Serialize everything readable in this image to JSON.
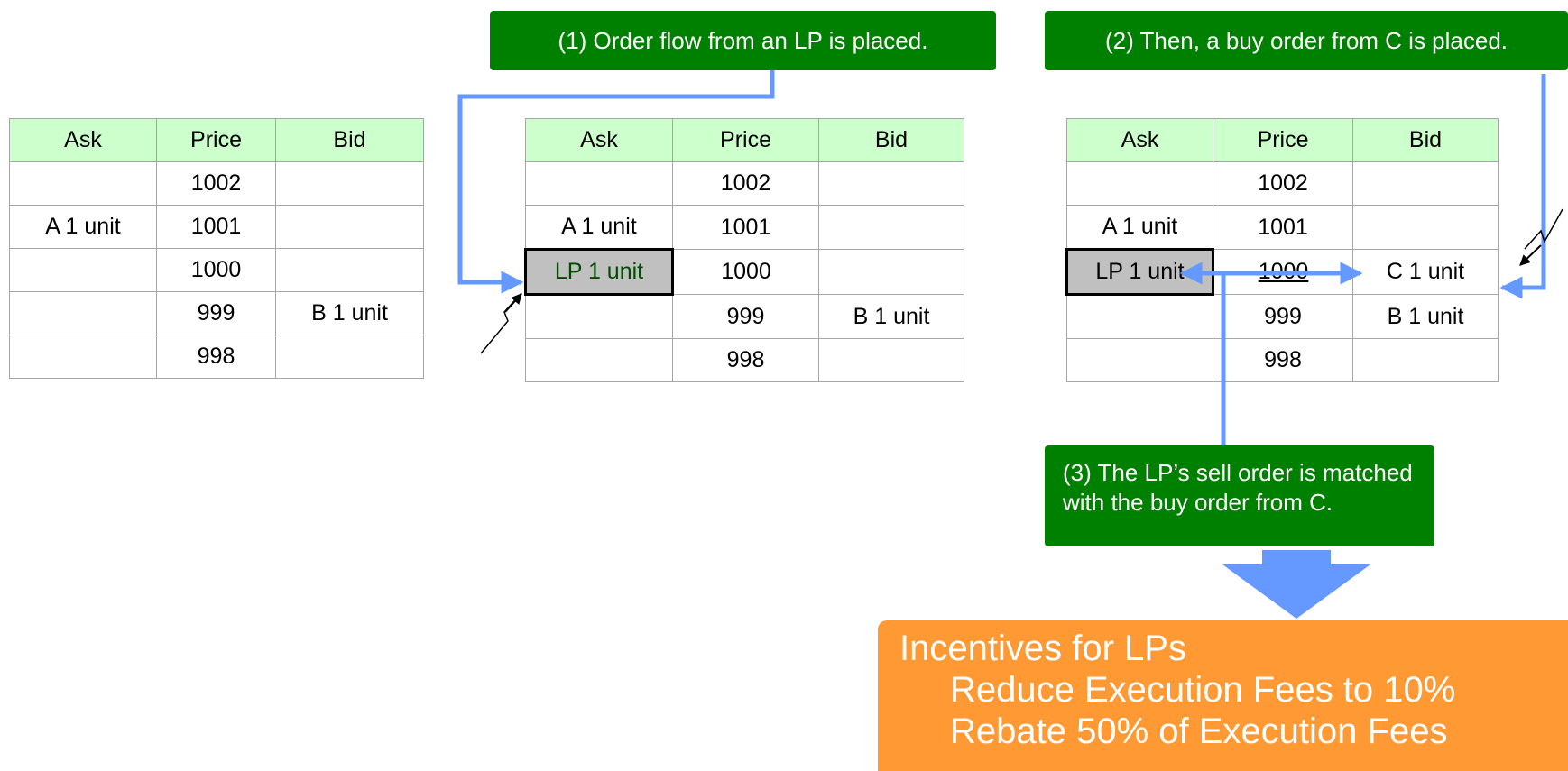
{
  "tables": [
    {
      "headers": {
        "ask": "Ask",
        "price": "Price",
        "bid": "Bid"
      },
      "rows": [
        {
          "ask": "",
          "price": "1002",
          "bid": ""
        },
        {
          "ask": "A 1 unit",
          "price": "1001",
          "bid": ""
        },
        {
          "ask": "",
          "price": "1000",
          "bid": ""
        },
        {
          "ask": "",
          "price": "999",
          "bid": "B 1 unit"
        },
        {
          "ask": "",
          "price": "998",
          "bid": ""
        }
      ]
    },
    {
      "headers": {
        "ask": "Ask",
        "price": "Price",
        "bid": "Bid"
      },
      "rows": [
        {
          "ask": "",
          "price": "1002",
          "bid": ""
        },
        {
          "ask": "A 1 unit",
          "price": "1001",
          "bid": ""
        },
        {
          "ask": "LP 1 unit",
          "price": "1000",
          "bid": ""
        },
        {
          "ask": "",
          "price": "999",
          "bid": "B 1 unit"
        },
        {
          "ask": "",
          "price": "998",
          "bid": ""
        }
      ]
    },
    {
      "headers": {
        "ask": "Ask",
        "price": "Price",
        "bid": "Bid"
      },
      "rows": [
        {
          "ask": "",
          "price": "1002",
          "bid": ""
        },
        {
          "ask": "A 1 unit",
          "price": "1001",
          "bid": ""
        },
        {
          "ask": "LP 1 unit",
          "price": "1000",
          "bid": "C 1 unit"
        },
        {
          "ask": "",
          "price": "999",
          "bid": "B 1 unit"
        },
        {
          "ask": "",
          "price": "998",
          "bid": ""
        }
      ]
    }
  ],
  "callouts": {
    "step1": "(1) Order flow from an LP is placed.",
    "step2": "(2) Then, a buy order from C is placed.",
    "step3_line1": "(3)  The LP’s sell order is matched",
    "step3_line2": "with the buy order from C."
  },
  "incentives": {
    "title": "Incentives for LPs",
    "line1": "Reduce Execution Fees to 10%",
    "line2": "Rebate 50% of Execution Fees"
  },
  "colors": {
    "header_bg": "#ccffcc",
    "callout_bg": "#008000",
    "incentive_bg": "#ff9933",
    "arrow": "#6699ff",
    "lp_cell_bg": "#c0c0c0"
  }
}
